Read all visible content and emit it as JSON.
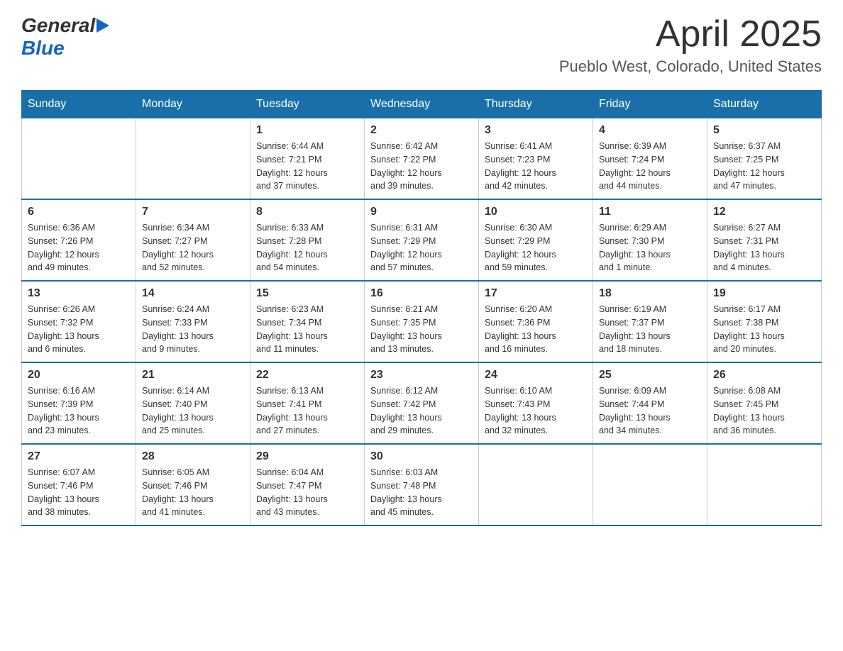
{
  "header": {
    "logo": {
      "general": "General",
      "blue": "Blue"
    },
    "title": "April 2025",
    "subtitle": "Pueblo West, Colorado, United States"
  },
  "calendar": {
    "days_of_week": [
      "Sunday",
      "Monday",
      "Tuesday",
      "Wednesday",
      "Thursday",
      "Friday",
      "Saturday"
    ],
    "weeks": [
      [
        {
          "day": "",
          "info": ""
        },
        {
          "day": "",
          "info": ""
        },
        {
          "day": "1",
          "info": "Sunrise: 6:44 AM\nSunset: 7:21 PM\nDaylight: 12 hours\nand 37 minutes."
        },
        {
          "day": "2",
          "info": "Sunrise: 6:42 AM\nSunset: 7:22 PM\nDaylight: 12 hours\nand 39 minutes."
        },
        {
          "day": "3",
          "info": "Sunrise: 6:41 AM\nSunset: 7:23 PM\nDaylight: 12 hours\nand 42 minutes."
        },
        {
          "day": "4",
          "info": "Sunrise: 6:39 AM\nSunset: 7:24 PM\nDaylight: 12 hours\nand 44 minutes."
        },
        {
          "day": "5",
          "info": "Sunrise: 6:37 AM\nSunset: 7:25 PM\nDaylight: 12 hours\nand 47 minutes."
        }
      ],
      [
        {
          "day": "6",
          "info": "Sunrise: 6:36 AM\nSunset: 7:26 PM\nDaylight: 12 hours\nand 49 minutes."
        },
        {
          "day": "7",
          "info": "Sunrise: 6:34 AM\nSunset: 7:27 PM\nDaylight: 12 hours\nand 52 minutes."
        },
        {
          "day": "8",
          "info": "Sunrise: 6:33 AM\nSunset: 7:28 PM\nDaylight: 12 hours\nand 54 minutes."
        },
        {
          "day": "9",
          "info": "Sunrise: 6:31 AM\nSunset: 7:29 PM\nDaylight: 12 hours\nand 57 minutes."
        },
        {
          "day": "10",
          "info": "Sunrise: 6:30 AM\nSunset: 7:29 PM\nDaylight: 12 hours\nand 59 minutes."
        },
        {
          "day": "11",
          "info": "Sunrise: 6:29 AM\nSunset: 7:30 PM\nDaylight: 13 hours\nand 1 minute."
        },
        {
          "day": "12",
          "info": "Sunrise: 6:27 AM\nSunset: 7:31 PM\nDaylight: 13 hours\nand 4 minutes."
        }
      ],
      [
        {
          "day": "13",
          "info": "Sunrise: 6:26 AM\nSunset: 7:32 PM\nDaylight: 13 hours\nand 6 minutes."
        },
        {
          "day": "14",
          "info": "Sunrise: 6:24 AM\nSunset: 7:33 PM\nDaylight: 13 hours\nand 9 minutes."
        },
        {
          "day": "15",
          "info": "Sunrise: 6:23 AM\nSunset: 7:34 PM\nDaylight: 13 hours\nand 11 minutes."
        },
        {
          "day": "16",
          "info": "Sunrise: 6:21 AM\nSunset: 7:35 PM\nDaylight: 13 hours\nand 13 minutes."
        },
        {
          "day": "17",
          "info": "Sunrise: 6:20 AM\nSunset: 7:36 PM\nDaylight: 13 hours\nand 16 minutes."
        },
        {
          "day": "18",
          "info": "Sunrise: 6:19 AM\nSunset: 7:37 PM\nDaylight: 13 hours\nand 18 minutes."
        },
        {
          "day": "19",
          "info": "Sunrise: 6:17 AM\nSunset: 7:38 PM\nDaylight: 13 hours\nand 20 minutes."
        }
      ],
      [
        {
          "day": "20",
          "info": "Sunrise: 6:16 AM\nSunset: 7:39 PM\nDaylight: 13 hours\nand 23 minutes."
        },
        {
          "day": "21",
          "info": "Sunrise: 6:14 AM\nSunset: 7:40 PM\nDaylight: 13 hours\nand 25 minutes."
        },
        {
          "day": "22",
          "info": "Sunrise: 6:13 AM\nSunset: 7:41 PM\nDaylight: 13 hours\nand 27 minutes."
        },
        {
          "day": "23",
          "info": "Sunrise: 6:12 AM\nSunset: 7:42 PM\nDaylight: 13 hours\nand 29 minutes."
        },
        {
          "day": "24",
          "info": "Sunrise: 6:10 AM\nSunset: 7:43 PM\nDaylight: 13 hours\nand 32 minutes."
        },
        {
          "day": "25",
          "info": "Sunrise: 6:09 AM\nSunset: 7:44 PM\nDaylight: 13 hours\nand 34 minutes."
        },
        {
          "day": "26",
          "info": "Sunrise: 6:08 AM\nSunset: 7:45 PM\nDaylight: 13 hours\nand 36 minutes."
        }
      ],
      [
        {
          "day": "27",
          "info": "Sunrise: 6:07 AM\nSunset: 7:46 PM\nDaylight: 13 hours\nand 38 minutes."
        },
        {
          "day": "28",
          "info": "Sunrise: 6:05 AM\nSunset: 7:46 PM\nDaylight: 13 hours\nand 41 minutes."
        },
        {
          "day": "29",
          "info": "Sunrise: 6:04 AM\nSunset: 7:47 PM\nDaylight: 13 hours\nand 43 minutes."
        },
        {
          "day": "30",
          "info": "Sunrise: 6:03 AM\nSunset: 7:48 PM\nDaylight: 13 hours\nand 45 minutes."
        },
        {
          "day": "",
          "info": ""
        },
        {
          "day": "",
          "info": ""
        },
        {
          "day": "",
          "info": ""
        }
      ]
    ]
  }
}
